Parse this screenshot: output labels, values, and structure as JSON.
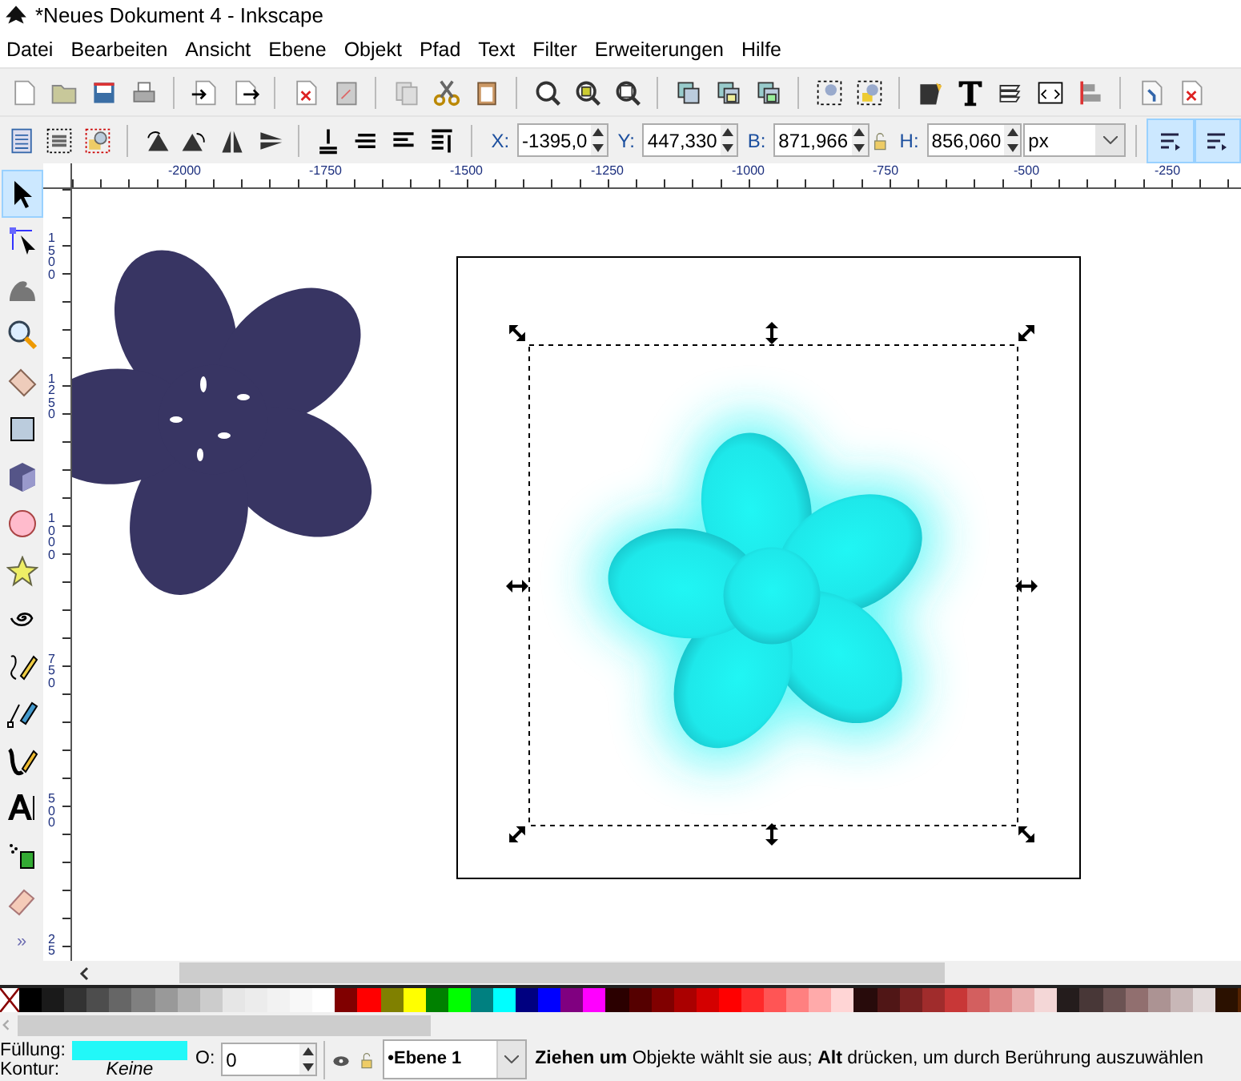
{
  "window": {
    "title": "*Neues Dokument 4 - Inkscape"
  },
  "menu": [
    {
      "label": "Datei"
    },
    {
      "label": "Bearbeiten"
    },
    {
      "label": "Ansicht"
    },
    {
      "label": "Ebene"
    },
    {
      "label": "Objekt"
    },
    {
      "label": "Pfad"
    },
    {
      "label": "Text"
    },
    {
      "label": "Filter"
    },
    {
      "label": "Erweiterungen"
    },
    {
      "label": "Hilfe"
    }
  ],
  "selection_toolbar": {
    "fields": [
      {
        "label": "X:",
        "value": "-1395,0"
      },
      {
        "label": "Y:",
        "value": "447,330"
      },
      {
        "label": "B:",
        "value": "871,966"
      },
      {
        "label": "H:",
        "value": "856,060"
      }
    ],
    "unit": "px",
    "toggles": [
      {
        "on": true
      },
      {
        "on": true
      }
    ]
  },
  "tools": [
    {
      "selected": true
    },
    {
      "selected": false
    },
    {
      "selected": false
    },
    {
      "selected": false
    },
    {
      "selected": false
    },
    {
      "selected": false
    },
    {
      "selected": false
    },
    {
      "selected": false
    },
    {
      "selected": false
    },
    {
      "selected": false
    },
    {
      "selected": false
    },
    {
      "selected": false
    },
    {
      "selected": false
    },
    {
      "selected": false
    },
    {
      "selected": false
    },
    {
      "selected": false
    }
  ],
  "tools_more": "»",
  "ruler_top": {
    "labels": [
      "-2000",
      "-1750",
      "-1500",
      "-1250",
      "-1000",
      "-750",
      "-500",
      "-250"
    ]
  },
  "ruler_left": {
    "labels": [
      "1500",
      "1250",
      "1000",
      "750",
      "500",
      "25"
    ]
  },
  "palette": [
    {
      "color": "#000000"
    },
    {
      "color": "#1a1a1a"
    },
    {
      "color": "#333333"
    },
    {
      "color": "#4d4d4d"
    },
    {
      "color": "#666666"
    },
    {
      "color": "#808080"
    },
    {
      "color": "#999999"
    },
    {
      "color": "#b3b3b3"
    },
    {
      "color": "#cccccc"
    },
    {
      "color": "#e6e6e6"
    },
    {
      "color": "#ececec"
    },
    {
      "color": "#f2f2f2"
    },
    {
      "color": "#f8f8f8"
    },
    {
      "color": "#ffffff"
    },
    {
      "color": "#800000"
    },
    {
      "color": "#ff0000"
    },
    {
      "color": "#808000"
    },
    {
      "color": "#ffff00"
    },
    {
      "color": "#008000"
    },
    {
      "color": "#00ff00"
    },
    {
      "color": "#008080"
    },
    {
      "color": "#00ffff"
    },
    {
      "color": "#000080"
    },
    {
      "color": "#0000ff"
    },
    {
      "color": "#800080"
    },
    {
      "color": "#ff00ff"
    },
    {
      "color": "#2b0000"
    },
    {
      "color": "#550000"
    },
    {
      "color": "#800000"
    },
    {
      "color": "#aa0000"
    },
    {
      "color": "#d40000"
    },
    {
      "color": "#ff0000"
    },
    {
      "color": "#ff2a2a"
    },
    {
      "color": "#ff5555"
    },
    {
      "color": "#ff8080"
    },
    {
      "color": "#ffaaaa"
    },
    {
      "color": "#ffd5d5"
    },
    {
      "color": "#280b0b"
    },
    {
      "color": "#501616"
    },
    {
      "color": "#782121"
    },
    {
      "color": "#a02c2c"
    },
    {
      "color": "#c83737"
    },
    {
      "color": "#d35f5f"
    },
    {
      "color": "#de8787"
    },
    {
      "color": "#e9afaf"
    },
    {
      "color": "#f4d7d7"
    },
    {
      "color": "#241c1c"
    },
    {
      "color": "#483737"
    },
    {
      "color": "#6c5353"
    },
    {
      "color": "#916f6f"
    },
    {
      "color": "#ac9393"
    },
    {
      "color": "#c8b7b7"
    },
    {
      "color": "#e3dbdb"
    },
    {
      "color": "#2b1100"
    },
    {
      "color": "#552200"
    }
  ],
  "status": {
    "fill_label": "Füllung:",
    "fill_swatch": {
      "color": "#22f8f8"
    },
    "stroke_label": "Kontur:",
    "stroke_value": "Keine",
    "opacity_label": "O:",
    "opacity_value": "0",
    "layer": "•Ebene 1",
    "message": "**Ziehen um** Objekte wählt sie aus; **Alt** drücken, um durch Berührung auszuwählen"
  }
}
